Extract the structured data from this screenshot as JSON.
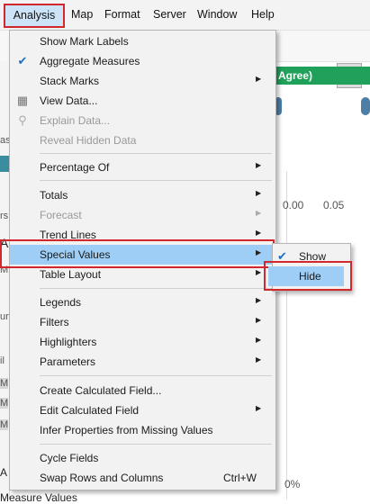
{
  "menubar": {
    "items": [
      "Analysis",
      "Map",
      "Format",
      "Server",
      "Window",
      "Help"
    ]
  },
  "background": {
    "green_pill": "Agree)",
    "axis_ticks": [
      "0.00",
      "0.05"
    ],
    "bottom_pct": "0%",
    "left_labels": [
      "as",
      "rs",
      "A",
      "M",
      "ur",
      "il",
      "M",
      "M",
      "M",
      "A"
    ],
    "bottom_left": "Measure Values"
  },
  "analysis_menu": {
    "show_mark_labels": "Show Mark Labels",
    "aggregate_measures": "Aggregate Measures",
    "stack_marks": "Stack Marks",
    "view_data": "View Data...",
    "explain_data": "Explain Data...",
    "reveal_hidden_data": "Reveal Hidden Data",
    "percentage_of": "Percentage Of",
    "totals": "Totals",
    "forecast": "Forecast",
    "trend_lines": "Trend Lines",
    "special_values": "Special Values",
    "table_layout": "Table Layout",
    "legends": "Legends",
    "filters": "Filters",
    "highlighters": "Highlighters",
    "parameters": "Parameters",
    "create_calculated_field": "Create Calculated Field...",
    "edit_calculated_field": "Edit Calculated Field",
    "infer_properties": "Infer Properties from Missing Values",
    "cycle_fields": "Cycle Fields",
    "swap_rows_columns": "Swap Rows and Columns",
    "swap_shortcut": "Ctrl+W"
  },
  "special_values_menu": {
    "show": "Show",
    "hide": "Hide"
  },
  "colors": {
    "highlight": "#9ecef5",
    "annotation_red": "#d1282e",
    "check_blue": "#1f6fc4"
  }
}
